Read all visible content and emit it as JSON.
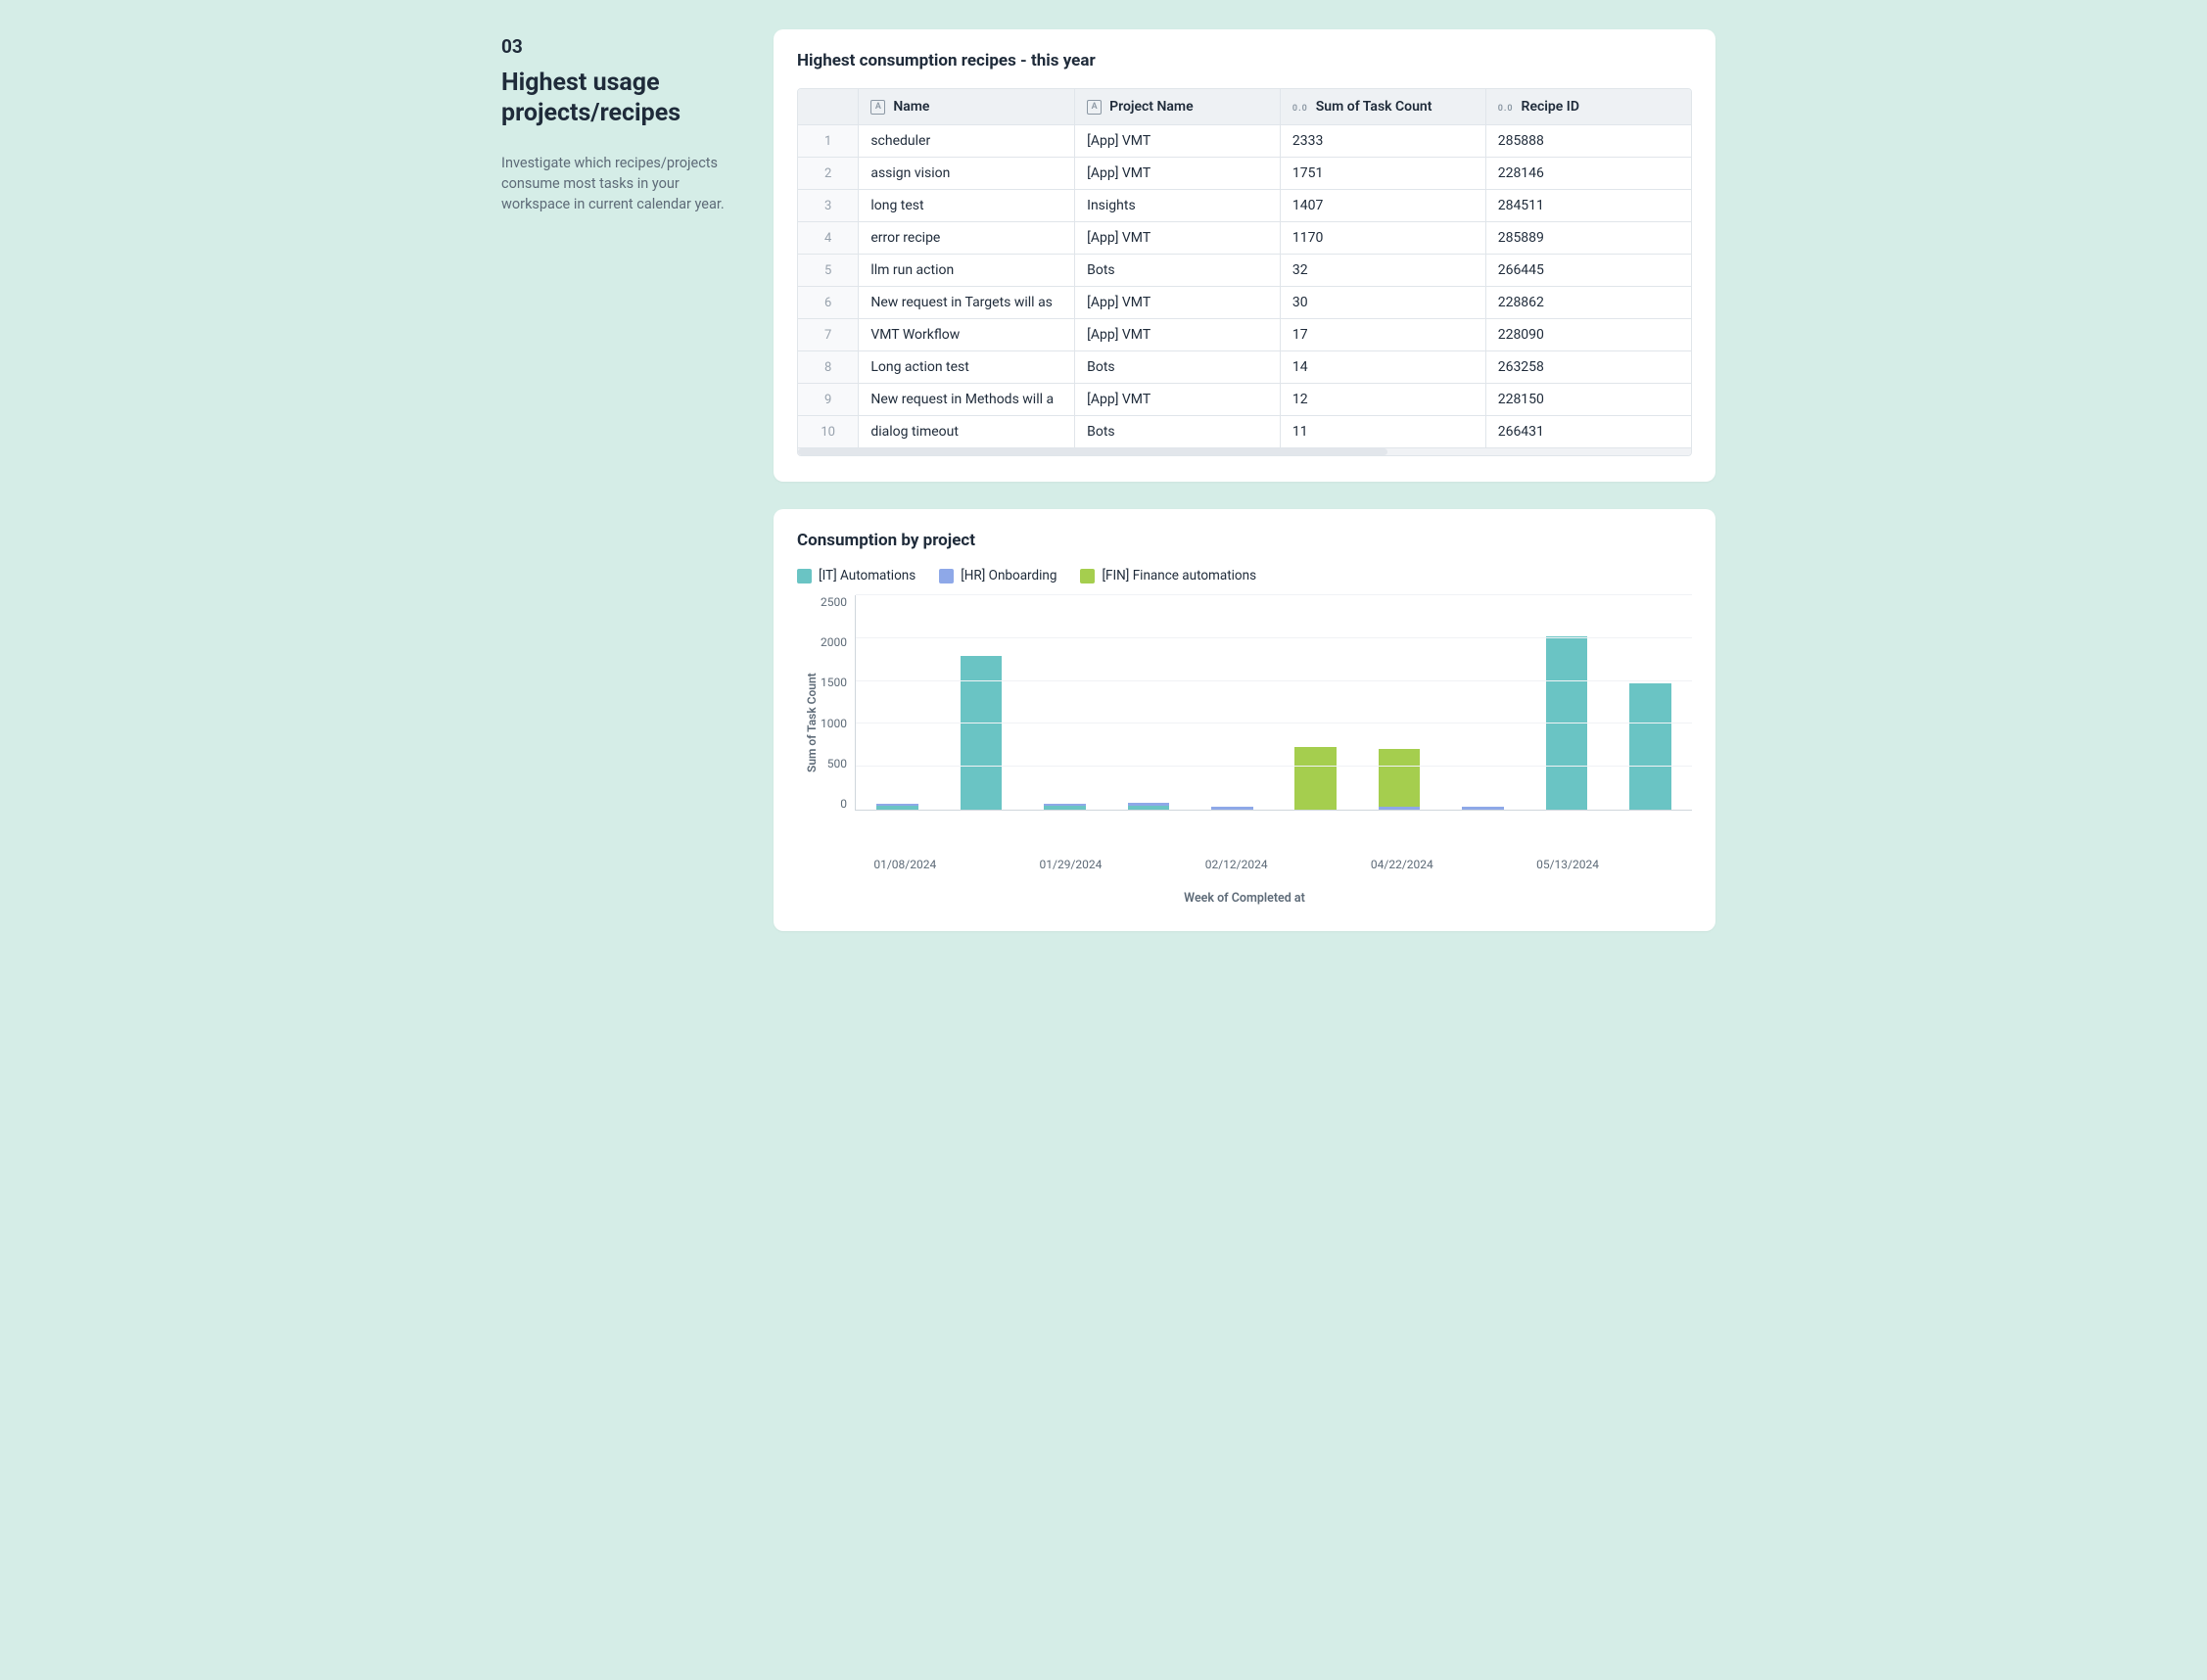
{
  "sidebar": {
    "number": "03",
    "title": "Highest usage projects/recipes",
    "description": "Investigate which recipes/projects consume most tasks in your workspace in current calendar year."
  },
  "table_card": {
    "title": "Highest consumption recipes - this year",
    "columns": {
      "name": "Name",
      "project": "Project Name",
      "task_count": "Sum of Task Count",
      "recipe_id": "Recipe ID"
    },
    "rows": [
      {
        "n": 1,
        "name": "scheduler",
        "project": "[App] VMT",
        "task_count": "2333",
        "recipe_id": "285888"
      },
      {
        "n": 2,
        "name": "assign vision",
        "project": "[App] VMT",
        "task_count": "1751",
        "recipe_id": "228146"
      },
      {
        "n": 3,
        "name": "long test",
        "project": "Insights",
        "task_count": "1407",
        "recipe_id": "284511"
      },
      {
        "n": 4,
        "name": "error recipe",
        "project": "[App] VMT",
        "task_count": "1170",
        "recipe_id": "285889"
      },
      {
        "n": 5,
        "name": "llm run action",
        "project": "Bots",
        "task_count": "32",
        "recipe_id": "266445"
      },
      {
        "n": 6,
        "name": "New request in Targets will as",
        "project": "[App] VMT",
        "task_count": "30",
        "recipe_id": "228862"
      },
      {
        "n": 7,
        "name": "VMT Workflow",
        "project": "[App] VMT",
        "task_count": "17",
        "recipe_id": "228090"
      },
      {
        "n": 8,
        "name": "Long action test",
        "project": "Bots",
        "task_count": "14",
        "recipe_id": "263258"
      },
      {
        "n": 9,
        "name": "New request in Methods will a",
        "project": "[App] VMT",
        "task_count": "12",
        "recipe_id": "228150"
      },
      {
        "n": 10,
        "name": "dialog timeout",
        "project": "Bots",
        "task_count": "11",
        "recipe_id": "266431"
      }
    ]
  },
  "chart_card": {
    "title": "Consumption by project",
    "legend": [
      {
        "label": "[IT] Automations",
        "color": "#6ac4c4"
      },
      {
        "label": "[HR] Onboarding",
        "color": "#8ea8e8"
      },
      {
        "label": "[FIN] Finance automations",
        "color": "#a5ce4e"
      }
    ],
    "xlabel": "Week of Completed at",
    "ylabel": "Sum of Task Count"
  },
  "chart_data": {
    "type": "bar",
    "title": "Consumption by project",
    "xlabel": "Week of Completed at",
    "ylabel": "Sum of Task Count",
    "ylim": [
      0,
      2500
    ],
    "yticks": [
      0,
      500,
      1000,
      1500,
      2000,
      2500
    ],
    "categories": [
      "01/08/2024",
      "",
      "01/29/2024",
      "",
      "02/12/2024",
      "",
      "04/22/2024",
      "",
      "05/13/2024",
      ""
    ],
    "series": [
      {
        "name": "[IT] Automations",
        "color": "#6ac4c4",
        "values": [
          40,
          1780,
          40,
          50,
          0,
          0,
          0,
          0,
          2010,
          1470
        ]
      },
      {
        "name": "[HR] Onboarding",
        "color": "#8ea8e8",
        "values": [
          30,
          0,
          30,
          30,
          30,
          0,
          30,
          30,
          0,
          0
        ]
      },
      {
        "name": "[FIN] Finance automations",
        "color": "#a5ce4e",
        "values": [
          0,
          0,
          0,
          0,
          0,
          730,
          670,
          0,
          0,
          0
        ]
      }
    ]
  }
}
